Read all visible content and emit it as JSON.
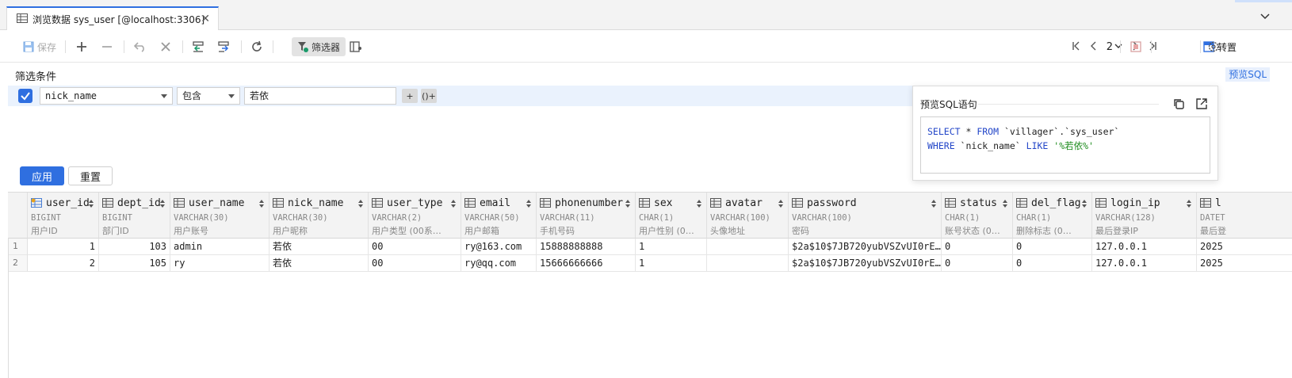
{
  "tab": {
    "title": "浏览数据 sys_user [@localhost:3306]",
    "close_symbol": "✕"
  },
  "toolbar": {
    "save_label": "保存",
    "filter_label": "筛选器",
    "page_number": "2",
    "transpose_label": "转置"
  },
  "filter": {
    "section_title": "筛选条件",
    "preview_sql_link": "预览SQL",
    "field": "nick_name",
    "operator": "包含",
    "value": "若依",
    "add_symbol": "+",
    "group_symbol": "()+"
  },
  "buttons": {
    "apply": "应用",
    "reset": "重置"
  },
  "preview": {
    "title": "预览SQL语句",
    "sql_select": "SELECT",
    "sql_star": " * ",
    "sql_from": "FROM",
    "sql_table": " `villager`.`sys_user`",
    "sql_where": "WHERE",
    "sql_col": " `nick_name` ",
    "sql_like": "LIKE",
    "sql_pattern": " '%若依%'"
  },
  "grid": {
    "columns": [
      {
        "name": "user_id",
        "type": "BIGINT",
        "comment": "用户ID",
        "key": true
      },
      {
        "name": "dept_id",
        "type": "BIGINT",
        "comment": "部门ID"
      },
      {
        "name": "user_name",
        "type": "VARCHAR(30)",
        "comment": "用户账号"
      },
      {
        "name": "nick_name",
        "type": "VARCHAR(30)",
        "comment": "用户昵称"
      },
      {
        "name": "user_type",
        "type": "VARCHAR(2)",
        "comment": "用户类型 (00系…"
      },
      {
        "name": "email",
        "type": "VARCHAR(50)",
        "comment": "用户邮箱"
      },
      {
        "name": "phonenumber",
        "type": "VARCHAR(11)",
        "comment": "手机号码"
      },
      {
        "name": "sex",
        "type": "CHAR(1)",
        "comment": "用户性别 (0…"
      },
      {
        "name": "avatar",
        "type": "VARCHAR(100)",
        "comment": "头像地址"
      },
      {
        "name": "password",
        "type": "VARCHAR(100)",
        "comment": "密码"
      },
      {
        "name": "status",
        "type": "CHAR(1)",
        "comment": "账号状态 (0…"
      },
      {
        "name": "del_flag",
        "type": "CHAR(1)",
        "comment": "删除标志 (0…"
      },
      {
        "name": "login_ip",
        "type": "VARCHAR(128)",
        "comment": "最后登录IP"
      },
      {
        "name": "l",
        "type": "DATET",
        "comment": "最后登"
      }
    ],
    "rows": [
      {
        "rownum": "1",
        "cells": [
          "1",
          "103",
          "admin",
          "若依",
          "00",
          "ry@163.com",
          "15888888888",
          "1",
          "",
          "$2a$10$7JB720yubVSZvUI0rE…",
          "0",
          "0",
          "127.0.0.1",
          "2025"
        ]
      },
      {
        "rownum": "2",
        "cells": [
          "2",
          "105",
          "ry",
          "若依",
          "00",
          "ry@qq.com",
          "15666666666",
          "1",
          "",
          "$2a$10$7JB720yubVSZvUI0rE…",
          "0",
          "0",
          "127.0.0.1",
          "2025"
        ]
      }
    ]
  },
  "colors": {
    "accent": "#2f6fe0",
    "keyword": "#2346c8",
    "string": "#1a8a1a"
  }
}
